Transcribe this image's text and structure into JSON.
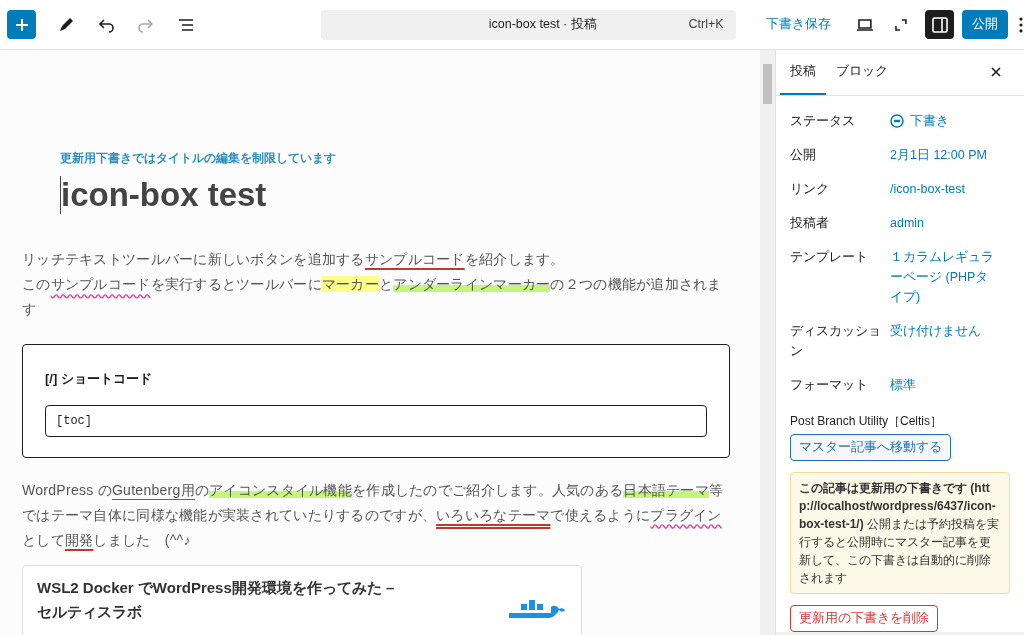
{
  "toolbar": {
    "title": "icon-box test · 投稿",
    "shortcut": "Ctrl+K",
    "save_draft": "下書き保存",
    "publish": "公開",
    "settings_open": true
  },
  "editor": {
    "notice": "更新用下書きではタイトルの編集を制限しています",
    "title": "icon-box test",
    "paragraphs": [
      [
        {
          "text": "リッチテキストツールバーに新しいボタンを追加する",
          "kind": "plain"
        },
        {
          "text": "サンプルコード",
          "kind": "red-underline"
        },
        {
          "text": "を紹介します。",
          "kind": "plain"
        }
      ],
      [
        {
          "text": "この",
          "kind": "plain"
        },
        {
          "text": "サンプルコード",
          "kind": "wavy"
        },
        {
          "text": "を実行するとツールバーに",
          "kind": "plain"
        },
        {
          "text": "マーカー",
          "kind": "yellow-marker"
        },
        {
          "text": "と",
          "kind": "plain"
        },
        {
          "text": "アンダーラインマーカー",
          "kind": "green-marker"
        },
        {
          "text": "の２つの機能が追加されます",
          "kind": "plain"
        }
      ]
    ],
    "shortcode": {
      "label": "[/] ショートコード",
      "value": "[toc]"
    },
    "paragraphs_2": [
      [
        {
          "text": "WordPress の",
          "kind": "plain"
        },
        {
          "text": "Gutenberg用",
          "kind": "gray-underline"
        },
        {
          "text": "の",
          "kind": "plain"
        },
        {
          "text": "アイコンスタイル機能",
          "kind": "green-marker"
        },
        {
          "text": "を作成したのでご紹介します。人気のある",
          "kind": "plain"
        },
        {
          "text": "日本語テーマ",
          "kind": "green-marker"
        },
        {
          "text": "等ではテーマ自体に同様な機能が実装されていたりするのですが、",
          "kind": "plain"
        },
        {
          "text": "いろいろなテーマ",
          "kind": "double-underline"
        },
        {
          "text": "で使えるように",
          "kind": "plain"
        },
        {
          "text": "プラグイン",
          "kind": "wavy"
        },
        {
          "text": "として",
          "kind": "plain"
        },
        {
          "text": "開発",
          "kind": "red-underline"
        },
        {
          "text": "しました　(^^♪",
          "kind": "plain"
        }
      ]
    ],
    "link_card": {
      "title": "WSL2 Docker でWordPress開発環境を作ってみた – セルティスラボ"
    }
  },
  "sidebar": {
    "tabs": [
      {
        "label": "投稿",
        "selected": true
      },
      {
        "label": "ブロック",
        "selected": false
      }
    ],
    "rows": [
      {
        "label": "ステータス",
        "value": "下書き",
        "kind": "status"
      },
      {
        "label": "公開",
        "value": "2月1日 12:00 PM",
        "kind": "link"
      },
      {
        "label": "リンク",
        "value": "/icon-box-test",
        "kind": "link"
      },
      {
        "label": "投稿者",
        "value": "admin",
        "kind": "link"
      },
      {
        "label": "テンプレート",
        "value": "１カラムレギュラーページ (PHPタイプ)",
        "kind": "link"
      },
      {
        "label": "ディスカッション",
        "value": "受け付けません",
        "kind": "link"
      },
      {
        "label": "フォーマット",
        "value": "標準",
        "kind": "link"
      }
    ],
    "branch_title": "Post Branch Utility［Celtis］",
    "master_button": "マスター記事へ移動する",
    "notice": "**この記事は更新用の下書きです (http://localhost/wordpress/6437/icon-box-test-1/)** 公開または予約投稿を実行すると公開時にマスター記事を更新して、この下書きは自動的に削除されます",
    "delete_button": "更新用の下書きを削除"
  }
}
